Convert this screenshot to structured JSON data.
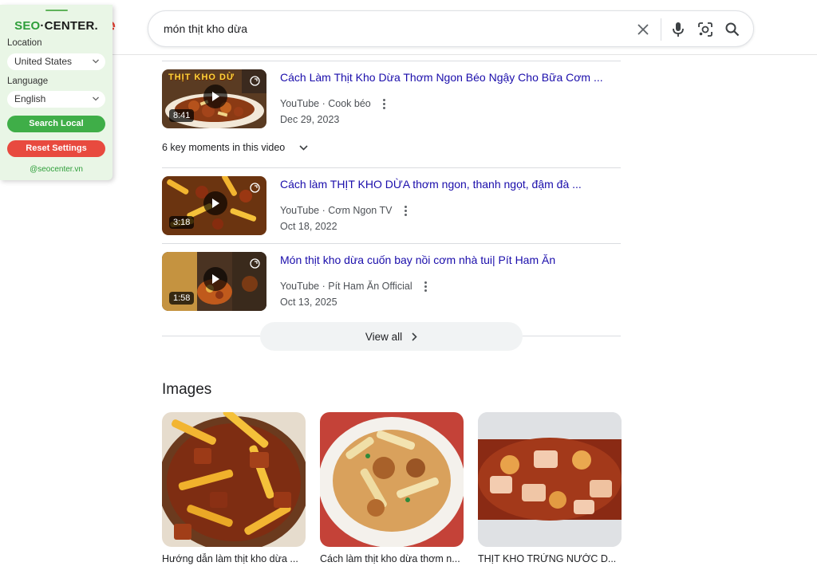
{
  "search": {
    "query": "món thịt kho dừa",
    "clear_icon": "close-icon",
    "voice_icon": "mic-icon",
    "lens_icon": "lens-icon",
    "search_icon": "search-icon"
  },
  "seo_panel": {
    "logo_part1": "SEO",
    "logo_part2": "·CENTER.",
    "location_label": "Location",
    "location_value": "United States",
    "language_label": "Language",
    "language_value": "English",
    "search_local": "Search Local",
    "reset_settings": "Reset Settings",
    "site": "@seocenter.vn",
    "colors": {
      "bg": "#e9f6e6",
      "green": "#3fae48",
      "red": "#e84a3f"
    }
  },
  "videos": [
    {
      "title": "Cách Làm Thịt Kho Dừa Thơm Ngon Béo Ngậy Cho Bữa Cơm ...",
      "source": "YouTube",
      "channel": "Cook béo",
      "date": "Dec 29, 2023",
      "duration": "8:41",
      "thumb_text": "THỊT KHO DỪ"
    },
    {
      "title": "Cách làm THỊT KHO DỪA thơm ngon, thanh ngọt, đậm đà ...",
      "source": "YouTube",
      "channel": "Cơm Ngon TV",
      "date": "Oct 18, 2022",
      "duration": "3:18"
    },
    {
      "title": "Món thịt kho dừa cuốn bay nồi cơm nhà tui| Pít Ham Ăn",
      "source": "YouTube",
      "channel": "Pít Ham Ăn Official",
      "date": "Oct 13, 2025",
      "duration": "1:58"
    }
  ],
  "key_moments": "6 key moments in this video",
  "view_all": "View all",
  "images_heading": "Images",
  "images": [
    {
      "caption": "Hướng dẫn làm thịt kho dừa ..."
    },
    {
      "caption": "Cách làm thịt kho dừa thơm n..."
    },
    {
      "caption": "THỊT KHO TRỨNG NƯỚC D..."
    }
  ],
  "colors": {
    "link": "#1a0dab",
    "meta": "#4d5156",
    "divider": "#dadce0"
  }
}
